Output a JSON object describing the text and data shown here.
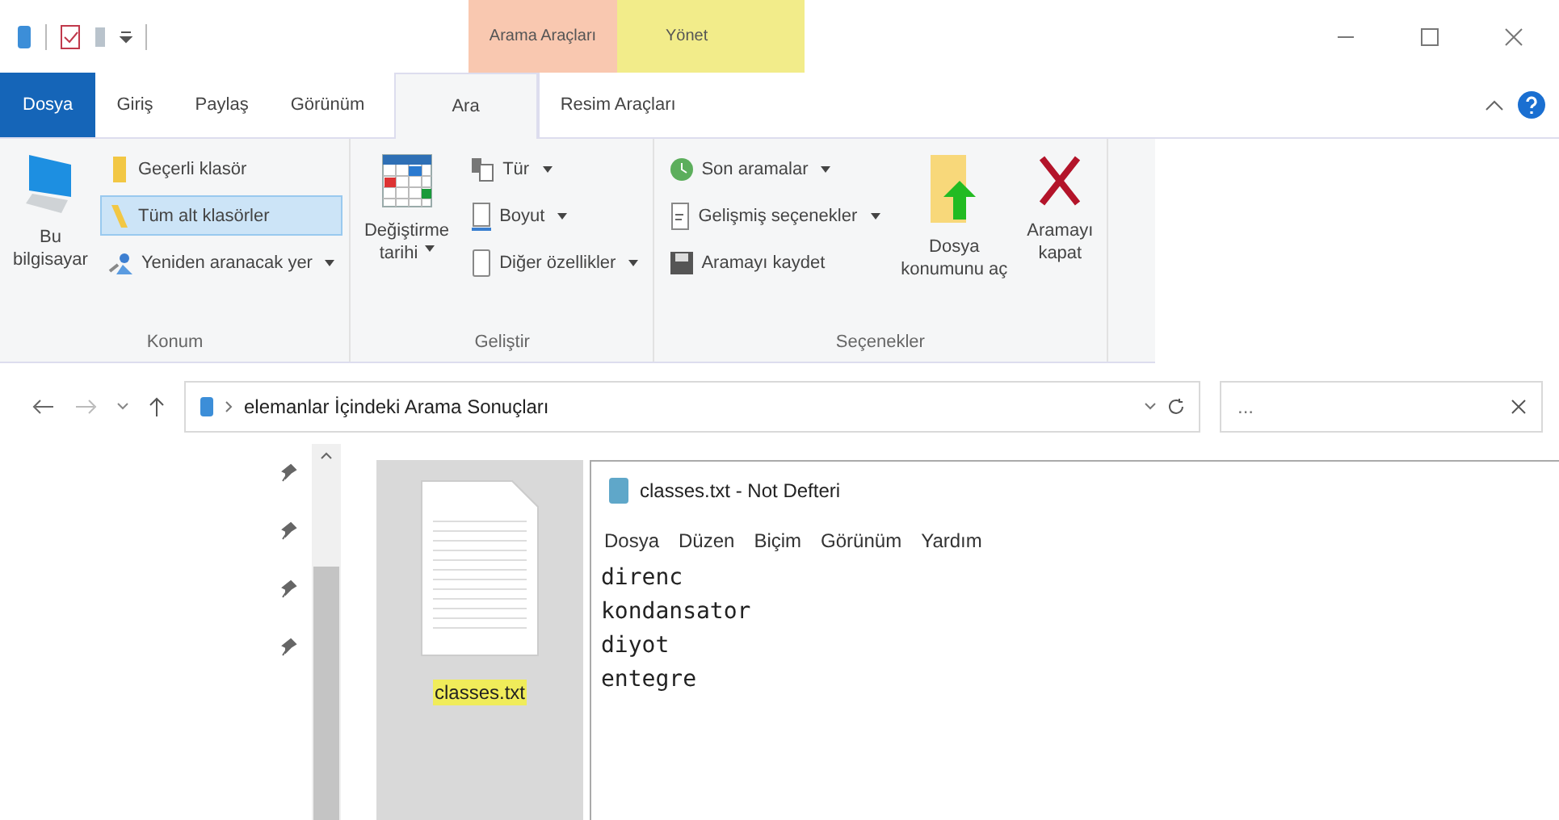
{
  "title_bar": {
    "context_tabs": [
      {
        "label": "Arama Araçları",
        "color": "#f9c8b0"
      },
      {
        "label": "Yönet",
        "color": "#f2ec8a"
      }
    ]
  },
  "ribbon_tabs": [
    {
      "label": "Dosya",
      "kind": "file",
      "selected": false
    },
    {
      "label": "Giriş",
      "kind": "tab",
      "selected": false
    },
    {
      "label": "Paylaş",
      "kind": "tab",
      "selected": false
    },
    {
      "label": "Görünüm",
      "kind": "tab",
      "selected": false
    },
    {
      "label": "Ara",
      "kind": "tab",
      "selected": true
    },
    {
      "label": "Resim Araçları",
      "kind": "tab",
      "selected": false
    }
  ],
  "ribbon_groups": [
    {
      "name": "Konum",
      "items": [
        {
          "kind": "big",
          "lines": [
            "Bu",
            "bilgisayar"
          ],
          "dropdown": false
        },
        {
          "kind": "stack",
          "children": [
            {
              "label": "Geçerli klasör",
              "selected": false,
              "dropdown": false
            },
            {
              "label": "Tüm alt klasörler",
              "selected": true,
              "dropdown": false
            },
            {
              "label": "Yeniden aranacak yer",
              "selected": false,
              "dropdown": true
            }
          ]
        }
      ]
    },
    {
      "name": "Geliştir",
      "items": [
        {
          "kind": "big",
          "lines": [
            "Değiştirme",
            "tarihi"
          ],
          "dropdown": true
        },
        {
          "kind": "stack",
          "children": [
            {
              "label": "Tür",
              "selected": false,
              "dropdown": true
            },
            {
              "label": "Boyut",
              "selected": false,
              "dropdown": true
            },
            {
              "label": "Diğer özellikler",
              "selected": false,
              "dropdown": true
            }
          ]
        }
      ]
    },
    {
      "name": "Seçenekler",
      "items": [
        {
          "kind": "stack",
          "children": [
            {
              "label": "Son aramalar",
              "selected": false,
              "dropdown": true
            },
            {
              "label": "Gelişmiş seçenekler",
              "selected": false,
              "dropdown": true
            },
            {
              "label": "Aramayı kaydet",
              "selected": false,
              "dropdown": false
            }
          ]
        },
        {
          "kind": "big",
          "lines": [
            "Dosya",
            "konumunu aç"
          ],
          "dropdown": false
        },
        {
          "kind": "big",
          "lines": [
            "Aramayı",
            "kapat"
          ],
          "dropdown": false
        }
      ]
    }
  ],
  "address_bar": {
    "path": "elemanlar İçindeki Arama Sonuçları"
  },
  "search": {
    "placeholder": "..."
  },
  "files": [
    {
      "name": "classes.txt",
      "highlighted": true
    }
  ],
  "notepad": {
    "title": "classes.txt - Not Defteri",
    "menu": [
      "Dosya",
      "Düzen",
      "Biçim",
      "Görünüm",
      "Yardım"
    ],
    "lines": [
      "direnc",
      "kondansator",
      "diyot",
      "entegre"
    ]
  }
}
